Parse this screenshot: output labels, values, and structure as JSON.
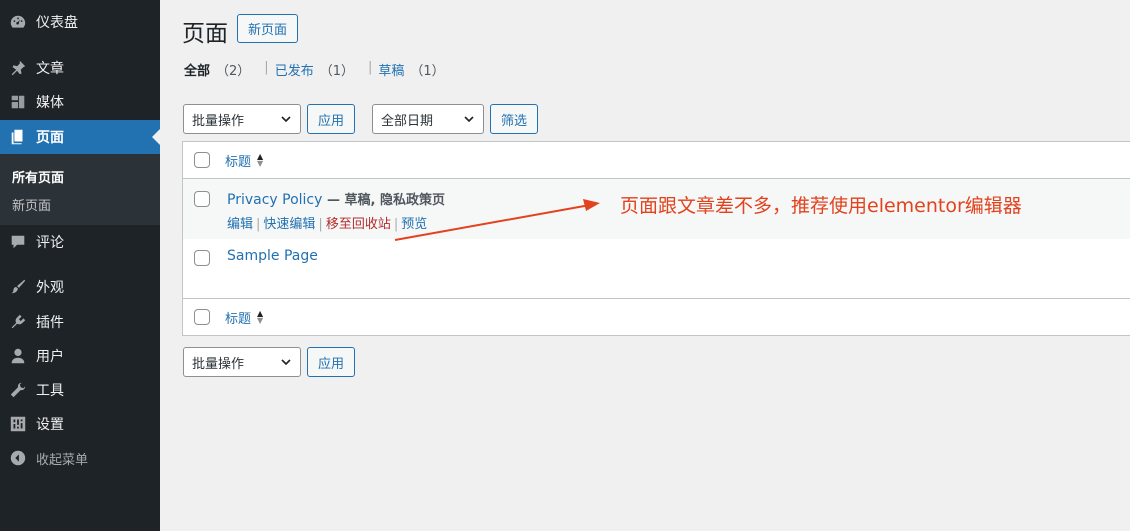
{
  "sidebar": {
    "items": [
      {
        "label": "仪表盘",
        "icon": "dashboard-icon"
      },
      {
        "label": "文章",
        "icon": "pin-icon"
      },
      {
        "label": "媒体",
        "icon": "media-icon"
      },
      {
        "label": "页面",
        "icon": "pages-icon"
      },
      {
        "label": "评论",
        "icon": "comment-icon"
      },
      {
        "label": "外观",
        "icon": "brush-icon"
      },
      {
        "label": "插件",
        "icon": "plugin-icon"
      },
      {
        "label": "用户",
        "icon": "user-icon"
      },
      {
        "label": "工具",
        "icon": "wrench-icon"
      },
      {
        "label": "设置",
        "icon": "settings-icon"
      }
    ],
    "submenu": [
      "所有页面",
      "新页面"
    ],
    "collapse_label": "收起菜单"
  },
  "header": {
    "title": "页面",
    "add_new": "新页面"
  },
  "filters": {
    "all": "全部",
    "all_count": "（2）",
    "published": "已发布",
    "published_count": "（1）",
    "draft": "草稿",
    "draft_count": "（1）",
    "sep": "|"
  },
  "bulk": {
    "select_value": "批量操作",
    "apply": "应用",
    "date_value": "全部日期",
    "filter": "筛选"
  },
  "table": {
    "column_title": "标题",
    "rows": [
      {
        "title": "Privacy Policy",
        "state": " — 草稿, 隐私政策页",
        "actions": {
          "edit": "编辑",
          "quick_edit": "快速编辑",
          "trash": "移至回收站",
          "preview": "预览"
        }
      },
      {
        "title": "Sample Page"
      }
    ]
  },
  "annotation": {
    "text": "页面跟文章差不多，推荐使用elementor编辑器",
    "color": "#e2431e"
  },
  "colors": {
    "sidebar_bg": "#1d2327",
    "accent": "#2271b1",
    "trash": "#b32d2e"
  }
}
